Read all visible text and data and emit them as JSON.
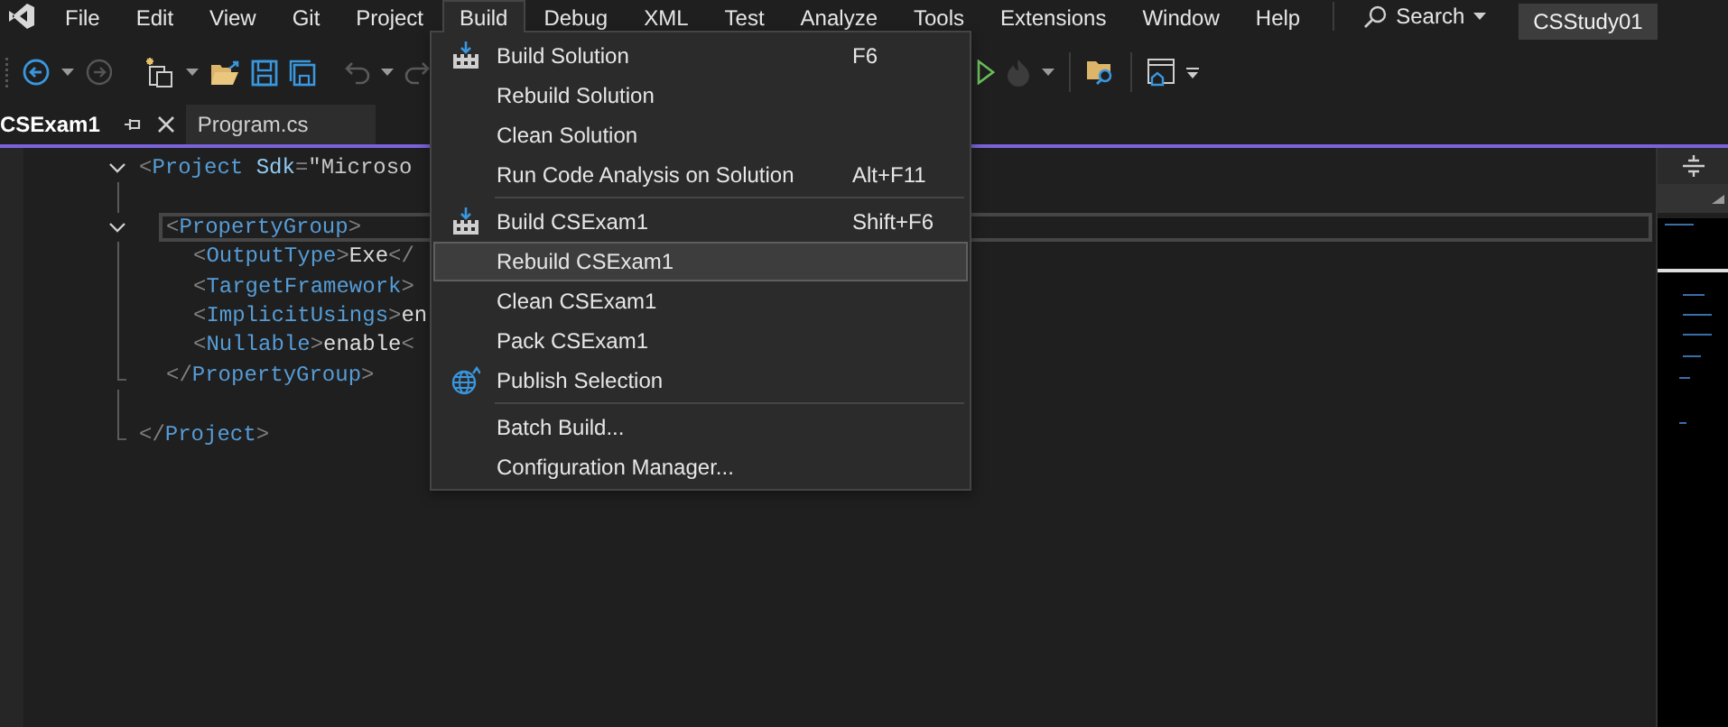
{
  "menubar": {
    "items": [
      {
        "label": "File",
        "selected": false
      },
      {
        "label": "Edit",
        "selected": false
      },
      {
        "label": "View",
        "selected": false
      },
      {
        "label": "Git",
        "selected": false
      },
      {
        "label": "Project",
        "selected": false
      },
      {
        "label": "Build",
        "selected": true
      },
      {
        "label": "Debug",
        "selected": false
      },
      {
        "label": "XML",
        "selected": false
      },
      {
        "label": "Test",
        "selected": false
      },
      {
        "label": "Analyze",
        "selected": false
      },
      {
        "label": "Tools",
        "selected": false
      },
      {
        "label": "Extensions",
        "selected": false
      },
      {
        "label": "Window",
        "selected": false
      },
      {
        "label": "Help",
        "selected": false
      }
    ],
    "search": "Search",
    "solution": "CSStudy01"
  },
  "tabs": [
    {
      "label": "CSExam1",
      "selected": true
    },
    {
      "label": "Program.cs",
      "selected": false
    }
  ],
  "editor": {
    "lines": [
      {
        "tokens": [
          {
            "kind": "punct",
            "text": "<"
          },
          {
            "kind": "tag",
            "text": "Project"
          },
          {
            "kind": "attr",
            "text": " Sdk"
          },
          {
            "kind": "punct",
            "text": "="
          },
          {
            "kind": "string",
            "text": "\"Microso"
          }
        ],
        "expanded": true,
        "current": false,
        "children": [
          {
            "kind": "blank"
          },
          {
            "tokens": [
              {
                "kind": "punct",
                "text": "<"
              },
              {
                "kind": "tag",
                "text": "PropertyGroup"
              },
              {
                "kind": "punct",
                "text": ">"
              }
            ],
            "expanded": true,
            "current": true,
            "children": [
              {
                "tokens": [
                  {
                    "kind": "punct",
                    "text": "<"
                  },
                  {
                    "kind": "tag",
                    "text": "OutputType"
                  },
                  {
                    "kind": "punct",
                    "text": ">"
                  },
                  {
                    "kind": "text",
                    "text": "Exe"
                  },
                  {
                    "kind": "punct",
                    "text": "</"
                  }
                ],
                "current": false
              },
              {
                "tokens": [
                  {
                    "kind": "punct",
                    "text": "<"
                  },
                  {
                    "kind": "tag",
                    "text": "TargetFramework"
                  },
                  {
                    "kind": "punct",
                    "text": ">"
                  }
                ],
                "current": false
              },
              {
                "tokens": [
                  {
                    "kind": "punct",
                    "text": "<"
                  },
                  {
                    "kind": "tag",
                    "text": "ImplicitUsings"
                  },
                  {
                    "kind": "punct",
                    "text": ">"
                  },
                  {
                    "kind": "text",
                    "text": "en"
                  }
                ],
                "current": false
              },
              {
                "tokens": [
                  {
                    "kind": "punct",
                    "text": "<"
                  },
                  {
                    "kind": "tag",
                    "text": "Nullable"
                  },
                  {
                    "kind": "punct",
                    "text": ">"
                  },
                  {
                    "kind": "text",
                    "text": "enable"
                  },
                  {
                    "kind": "punct",
                    "text": "<"
                  }
                ],
                "current": false
              }
            ],
            "close": [
              {
                "kind": "punct",
                "text": "</"
              },
              {
                "kind": "tag",
                "text": "PropertyGroup"
              },
              {
                "kind": "punct",
                "text": ">"
              }
            ]
          },
          {
            "kind": "blank"
          }
        ],
        "close": [
          {
            "kind": "punct",
            "text": "</"
          },
          {
            "kind": "tag",
            "text": "Project"
          },
          {
            "kind": "punct",
            "text": ">"
          }
        ]
      }
    ]
  },
  "build_menu": {
    "items": [
      {
        "kind": "build",
        "label": "Build Solution",
        "shortcut": "F6",
        "selected": false
      },
      {
        "kind": "plain",
        "label": "Rebuild Solution",
        "selected": false
      },
      {
        "kind": "plain",
        "label": "Clean Solution",
        "selected": false
      },
      {
        "kind": "plain",
        "label": "Run Code Analysis on Solution",
        "shortcut": "Alt+F11",
        "selected": false
      },
      {
        "kind": "separator"
      },
      {
        "kind": "build",
        "label": "Build CSExam1",
        "shortcut": "Shift+F6",
        "selected": false
      },
      {
        "kind": "plain",
        "label": "Rebuild CSExam1",
        "selected": true
      },
      {
        "kind": "plain",
        "label": "Clean CSExam1",
        "selected": false
      },
      {
        "kind": "plain",
        "label": "Pack CSExam1",
        "selected": false
      },
      {
        "kind": "publish",
        "label": "Publish Selection",
        "selected": false
      },
      {
        "kind": "separator"
      },
      {
        "kind": "plain",
        "label": "Batch Build...",
        "selected": false
      },
      {
        "kind": "plain",
        "label": "Configuration Manager...",
        "selected": false
      }
    ]
  }
}
